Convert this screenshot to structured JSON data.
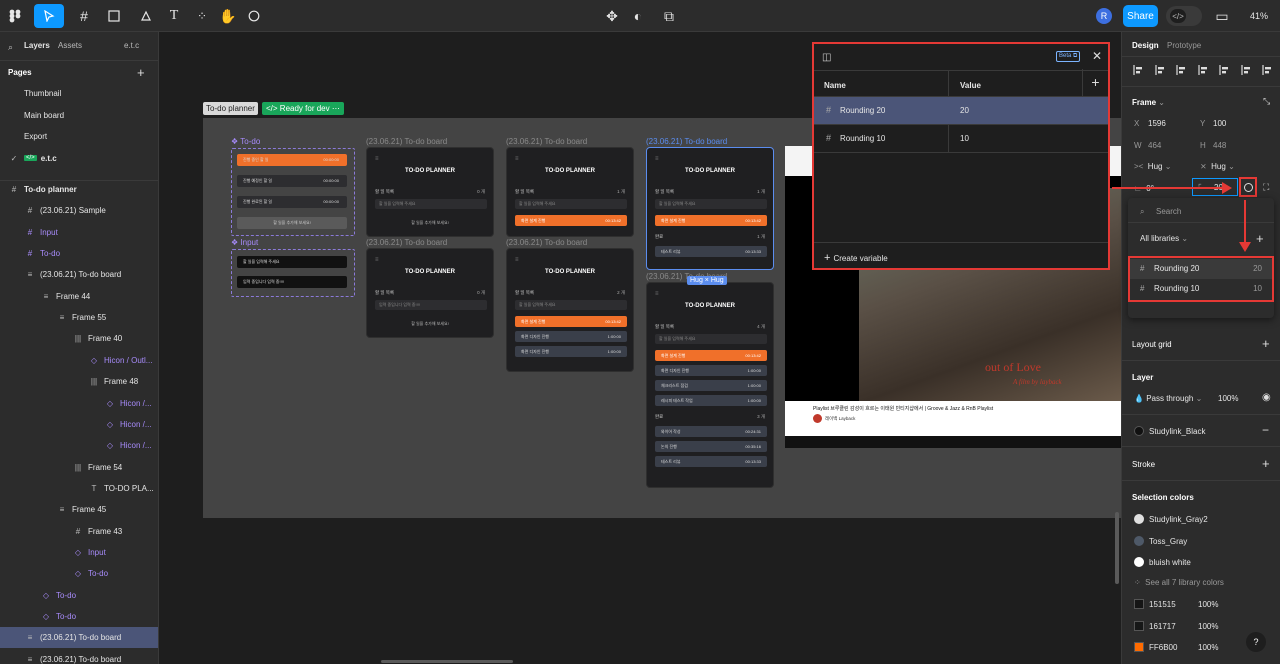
{
  "toolbar": {
    "avatar": "R",
    "share": "Share",
    "zoom": "41%"
  },
  "left": {
    "tabs": [
      "Layers",
      "Assets"
    ],
    "current_page_short": "e.t.c",
    "pages_title": "Pages",
    "pages": [
      "Thumbnail",
      "Main board",
      "Export",
      "e.t.c"
    ],
    "layers": [
      {
        "label": "To-do planner",
        "icon": "#",
        "indent": 0,
        "bold": true
      },
      {
        "label": "(23.06.21) Sample",
        "icon": "#",
        "indent": 1
      },
      {
        "label": "Input",
        "icon": "#",
        "indent": 1,
        "purple": true
      },
      {
        "label": "To-do",
        "icon": "#",
        "indent": 1,
        "purple": true
      },
      {
        "label": "(23.06.21) To-do board",
        "icon": "≡",
        "indent": 1
      },
      {
        "label": "Frame 44",
        "icon": "≡",
        "indent": 2
      },
      {
        "label": "Frame 55",
        "icon": "≡",
        "indent": 3
      },
      {
        "label": "Frame 40",
        "icon": "|||",
        "indent": 4
      },
      {
        "label": "Hicon / Outl...",
        "icon": "◇",
        "indent": 5,
        "purple": true
      },
      {
        "label": "Frame 48",
        "icon": "|||",
        "indent": 5
      },
      {
        "label": "Hicon /...",
        "icon": "◇",
        "indent": 6,
        "purple": true
      },
      {
        "label": "Hicon /...",
        "icon": "◇",
        "indent": 6,
        "purple": true
      },
      {
        "label": "Hicon /...",
        "icon": "◇",
        "indent": 6,
        "purple": true
      },
      {
        "label": "Frame 54",
        "icon": "|||",
        "indent": 4
      },
      {
        "label": "TO-DO PLA...",
        "icon": "T",
        "indent": 5
      },
      {
        "label": "Frame 45",
        "icon": "≡",
        "indent": 3
      },
      {
        "label": "Frame 43",
        "icon": "#",
        "indent": 4
      },
      {
        "label": "Input",
        "icon": "◇",
        "indent": 4,
        "purple": true
      },
      {
        "label": "To-do",
        "icon": "◇",
        "indent": 4,
        "purple": true
      },
      {
        "label": "To-do",
        "icon": "◇",
        "indent": 2,
        "purple": true
      },
      {
        "label": "To-do",
        "icon": "◇",
        "indent": 2,
        "purple": true
      },
      {
        "label": "(23.06.21) To-do board",
        "icon": "≡",
        "indent": 1,
        "selected": true
      },
      {
        "label": "(23.06.21) To-do board",
        "icon": "≡",
        "indent": 1
      }
    ]
  },
  "canvas": {
    "section_label": "To-do planner",
    "dev_badge": "Ready for dev",
    "comp_todo": "To-do",
    "comp_input": "Input",
    "board_title": "(23.06.21) To-do board",
    "planner_title": "TO-DO PLANNER",
    "todo_list_label": "할 일 목록",
    "input_placeholder": "할 일을 입력해 주세요",
    "add_todo": "할 일을 추가해 보세요!",
    "hug_label": "Hug × Hug",
    "done_label": "완료",
    "todo_rows": [
      {
        "text": "진행 중인 할 일",
        "time": "00:00:00",
        "style": "orange"
      },
      {
        "text": "진행 예정인 할 일",
        "time": "00:00:00",
        "style": "gray"
      },
      {
        "text": "진행 완료된 할 일",
        "time": "00:00:00",
        "style": "gray"
      }
    ],
    "input_rows": [
      "할 일을 입력해 주세요",
      "입력 중입니다 입력 중!!!!"
    ],
    "tasks": {
      "t1": "화면 설계 진행",
      "t1_time": "00:13:42",
      "t2": "화면 디자인 진행",
      "t2_time": "1:00:00",
      "t3": "테스트 리뷰",
      "t3_time": "00:13:33",
      "t4": "체크리스트 점검",
      "t5": "레시피 테스트 작업",
      "t6": "와이어 작성",
      "t6_time": "00:24:31",
      "t7": "논의 진행",
      "t7_time": "00:35:16",
      "typing": "입력 중입니다 입력 중!!!!"
    },
    "counts": {
      "c0": "0 개",
      "c1": "1 개",
      "c2": "2 개",
      "c4": "4 개",
      "c3": "3 개"
    },
    "video": {
      "title": "Playlist 브루클린 감성이 흐르는 이태원 빈티지샵에서 | Groove & Jazz & RnB Playlist",
      "channel": "레이백 Layback",
      "overlay1": "out of Love",
      "overlay2": "A film by layback"
    }
  },
  "variables": {
    "beta": "Beta",
    "col_name": "Name",
    "col_value": "Value",
    "rows": [
      {
        "name": "Rounding 20",
        "value": "20"
      },
      {
        "name": "Rounding 10",
        "value": "10"
      }
    ],
    "create": "Create variable"
  },
  "right": {
    "tabs": [
      "Design",
      "Prototype"
    ],
    "frame_title": "Frame",
    "x_label": "X",
    "x": "1596",
    "y_label": "Y",
    "y": "100",
    "w_label": "W",
    "w": "464",
    "h_label": "H",
    "h": "448",
    "hug_w": "Hug",
    "hug_h": "Hug",
    "rotation": "0°",
    "radius": "20",
    "search_placeholder": "Search",
    "all_libraries": "All libraries",
    "lib_rows": [
      {
        "name": "Rounding 20",
        "value": "20"
      },
      {
        "name": "Rounding 10",
        "value": "10"
      }
    ],
    "layout_grid": "Layout grid",
    "layer_title": "Layer",
    "pass_through": "Pass through",
    "opacity": "100%",
    "fill_style": "Studylink_Black",
    "stroke": "Stroke",
    "selection_colors": "Selection colors",
    "colors": [
      {
        "name": "Studylink_Gray2",
        "hex": "#e0e0e0"
      },
      {
        "name": "Toss_Gray",
        "hex": "#4e5968"
      },
      {
        "name": "bluish white",
        "hex": "#ffffff"
      }
    ],
    "see_all": "See all 7 library colors",
    "hex_colors": [
      {
        "hex": "151515",
        "opacity": "100%",
        "color": "#151515"
      },
      {
        "hex": "161717",
        "opacity": "100%",
        "color": "#161717"
      },
      {
        "hex": "FF6B00",
        "opacity": "100%",
        "color": "#ff6b00"
      }
    ],
    "help": "?"
  },
  "colors": {
    "accent": "#0d99ff",
    "highlight": "#e53935",
    "selected_row": "#4b5578",
    "orange": "#f0702a"
  }
}
